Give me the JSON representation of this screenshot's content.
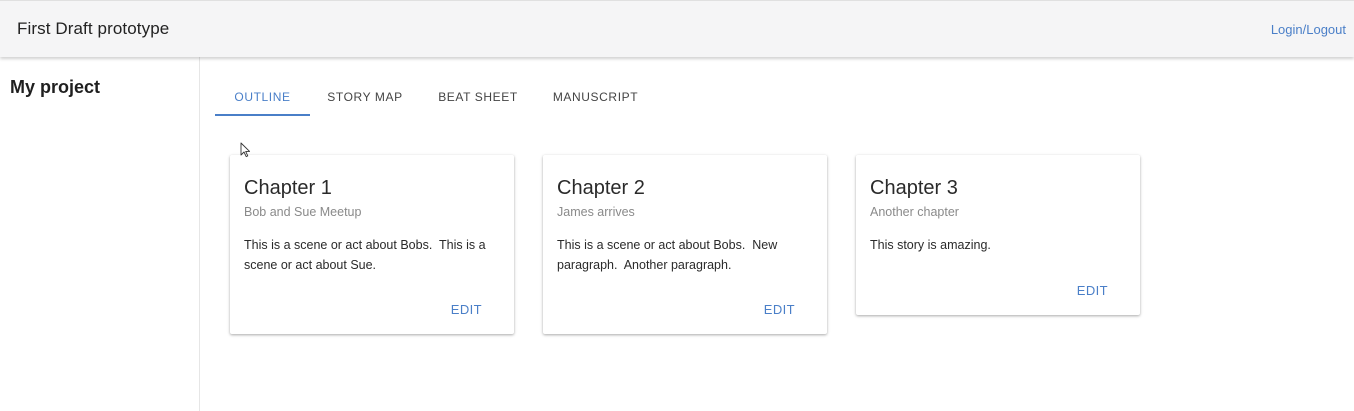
{
  "header": {
    "app_title": "First Draft prototype",
    "login_label": "Login/Logout"
  },
  "sidebar": {
    "project_title": "My project"
  },
  "tabs": [
    {
      "label": "OUTLINE",
      "active": true
    },
    {
      "label": "STORY MAP",
      "active": false
    },
    {
      "label": "BEAT SHEET",
      "active": false
    },
    {
      "label": "MANUSCRIPT",
      "active": false
    }
  ],
  "cards": [
    {
      "title": "Chapter 1",
      "subtitle": "Bob and Sue Meetup",
      "body": "This is a scene or act about Bobs.  This is a scene or act about Sue.",
      "edit_label": "EDIT"
    },
    {
      "title": "Chapter 2",
      "subtitle": "James arrives",
      "body": "This is a scene or act about Bobs.  New paragraph.  Another paragraph.",
      "edit_label": "EDIT"
    },
    {
      "title": "Chapter 3",
      "subtitle": "Another chapter",
      "body": "This story is amazing.",
      "edit_label": "EDIT"
    }
  ],
  "colors": {
    "accent": "#4a7fc8",
    "appbar_bg": "#f5f5f6"
  },
  "icons": {
    "cursor": "mouse-pointer-icon"
  }
}
